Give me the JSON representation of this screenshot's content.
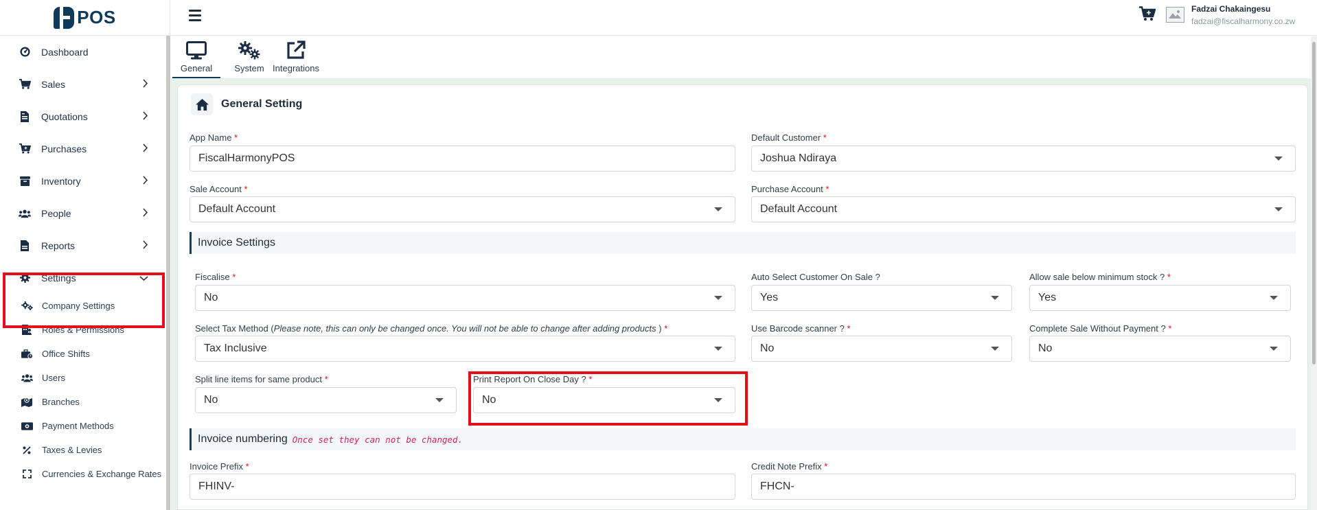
{
  "app": {
    "logo_text": "POS"
  },
  "header": {
    "user_name": "Fadzai Chakaingesu",
    "user_email": "fadzai@fiscalharmony.co.zw"
  },
  "sidebar": {
    "items": [
      {
        "label": "Dashboard",
        "icon": "dashboard-icon"
      },
      {
        "label": "Sales",
        "icon": "cart-icon"
      },
      {
        "label": "Quotations",
        "icon": "file-invoice-icon"
      },
      {
        "label": "Purchases",
        "icon": "cart-plus-icon"
      },
      {
        "label": "Inventory",
        "icon": "box-icon"
      },
      {
        "label": "People",
        "icon": "users-icon"
      },
      {
        "label": "Reports",
        "icon": "file-icon"
      },
      {
        "label": "Settings",
        "icon": "gear-icon"
      }
    ],
    "settings_sub": [
      {
        "label": "Company Settings",
        "icon": "gears-icon"
      },
      {
        "label": "Roles & Permissions",
        "icon": "user-tie-icon"
      },
      {
        "label": "Office Shifts",
        "icon": "briefcase-icon"
      },
      {
        "label": "Users",
        "icon": "users-icon"
      },
      {
        "label": "Branches",
        "icon": "map-icon"
      },
      {
        "label": "Payment Methods",
        "icon": "money-icon"
      },
      {
        "label": "Taxes & Levies",
        "icon": "percent-icon"
      },
      {
        "label": "Currencies & Exchange Rates",
        "icon": "expand-icon"
      }
    ]
  },
  "tabs": [
    {
      "label": "General",
      "icon": "desktop-icon",
      "active": true
    },
    {
      "label": "System",
      "icon": "gears-icon",
      "active": false
    },
    {
      "label": "Integrations",
      "icon": "external-link-icon",
      "active": false
    }
  ],
  "card": {
    "title": "General Setting"
  },
  "form": {
    "app_name": {
      "label": "App Name",
      "value": "FiscalHarmonyPOS"
    },
    "default_customer": {
      "label": "Default Customer",
      "value": "Joshua Ndiraya"
    },
    "sale_account": {
      "label": "Sale Account",
      "value": "Default Account"
    },
    "purchase_account": {
      "label": "Purchase Account",
      "value": "Default Account"
    },
    "invoice_settings_title": "Invoice Settings",
    "fiscalise": {
      "label": "Fiscalise",
      "value": "No"
    },
    "auto_select_customer": {
      "label": "Auto Select Customer On Sale ?",
      "value": "Yes"
    },
    "allow_below_min": {
      "label": "Allow sale below minimum stock ?",
      "value": "Yes"
    },
    "tax_method": {
      "label": "Select Tax Method (",
      "note": "Please note, this can only be changed once. You will not be able to change after adding products",
      "label_end": ")",
      "value": "Tax Inclusive"
    },
    "use_barcode": {
      "label": "Use Barcode scanner ?",
      "value": "No"
    },
    "complete_without_payment": {
      "label": "Complete Sale Without Payment ?",
      "value": "No"
    },
    "split_line_items": {
      "label": "Split line items for same product",
      "value": "No"
    },
    "print_report": {
      "label": "Print Report On Close Day ?",
      "value": "No"
    },
    "invoice_numbering_title": "Invoice numbering",
    "invoice_numbering_note": "Once set they can not be changed.",
    "invoice_prefix": {
      "label": "Invoice Prefix",
      "value": "FHINV-"
    },
    "credit_note_prefix": {
      "label": "Credit Note Prefix",
      "value": "FHCN-"
    }
  },
  "colors": {
    "brand": "#0e3b5c",
    "highlight": "#e3101b",
    "required": "#e3101b",
    "content_bg": "#e8f1ea"
  }
}
